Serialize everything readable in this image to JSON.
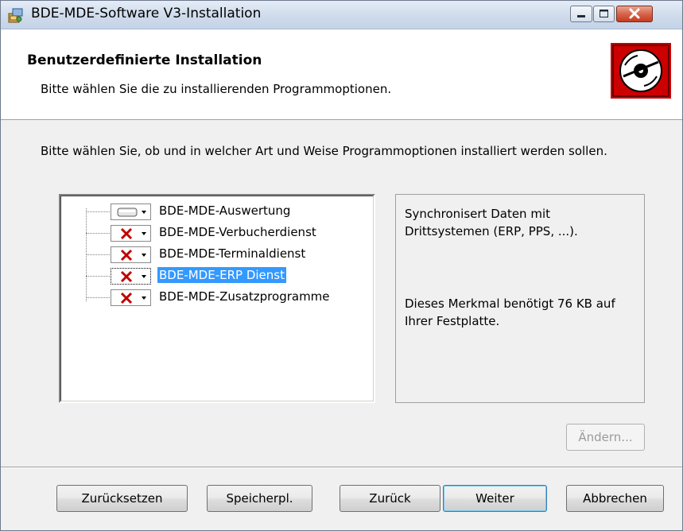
{
  "window": {
    "title": "BDE-MDE-Software V3-Installation"
  },
  "header": {
    "title": "Benutzerdefinierte Installation",
    "subtitle": "Bitte wählen Sie die zu installierenden Programmoptionen."
  },
  "instruction": "Bitte wählen Sie, ob und in welcher Art und Weise Programmoptionen installiert werden sollen.",
  "features": [
    {
      "label": "BDE-MDE-Auswertung",
      "state_icon": "drive-icon",
      "selected": false
    },
    {
      "label": "BDE-MDE-Verbucherdienst",
      "state_icon": "red-x-icon",
      "selected": false
    },
    {
      "label": "BDE-MDE-Terminaldienst",
      "state_icon": "red-x-icon",
      "selected": false
    },
    {
      "label": "BDE-MDE-ERP Dienst",
      "state_icon": "red-x-icon",
      "selected": true
    },
    {
      "label": "BDE-MDE-Zusatzprogramme",
      "state_icon": "red-x-icon",
      "selected": false
    }
  ],
  "description": {
    "text": "Synchronisert Daten mit Drittsystemen (ERP, PPS, ...).",
    "size": "Dieses Merkmal benötigt 76 KB auf Ihrer Festplatte."
  },
  "buttons": {
    "change": "Ändern...",
    "reset": "Zurücksetzen",
    "location": "Speicherpl.",
    "back": "Zurück",
    "next": "Weiter",
    "cancel": "Abbrechen"
  },
  "colors": {
    "selection": "#3399ff",
    "logo_red": "#cc0000",
    "x_red": "#c00000"
  }
}
